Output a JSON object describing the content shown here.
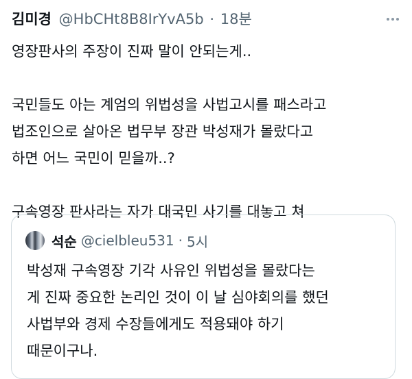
{
  "tweet": {
    "author_name": "김미경",
    "author_handle": "@HbCHt8B8IrYvA5b",
    "separator": "·",
    "time": "18분",
    "more_icon": "more-dots-icon",
    "lines": [
      "영장판사의 주장이 진짜 말이 안되는게..",
      "",
      "국민들도 아는 계엄의 위법성을 사법고시를 패스라고",
      "법조인으로 살아온 법무부 장관 박성재가 몰랐다고",
      "하면 어느 국민이 믿을까..?",
      "",
      "구속영장 판사라는 자가 대국민 사기를 대놓고 쳐"
    ]
  },
  "quoted": {
    "avatar_icon": "avatar-icon",
    "author_name": "석순",
    "author_handle": "@cielbleu531",
    "separator": "·",
    "time": "5시",
    "lines": [
      "박성재 구속영장 기각 사유인 위법성을 몰랐다는",
      "게 진짜 중요한 논리인 것이 이 날 심야회의를 했던",
      "사법부와 경제 수장들에게도 적용돼야 하기",
      "때문이구나."
    ]
  },
  "colors": {
    "text": "#0f1419",
    "secondary": "#536471",
    "border": "#cfd9de"
  }
}
